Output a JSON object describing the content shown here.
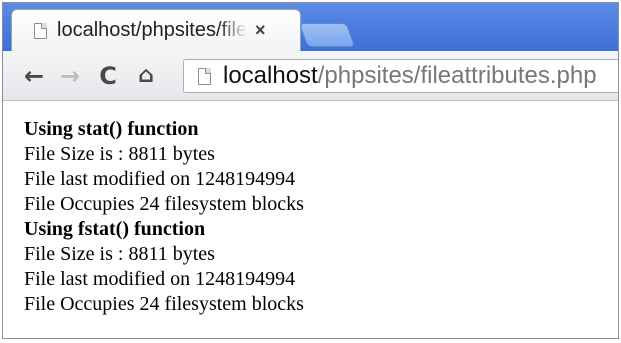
{
  "tab": {
    "title": "localhost/phpsites/file",
    "close_glyph": "×"
  },
  "toolbar": {
    "back_glyph": "←",
    "forward_glyph": "→",
    "reload_glyph": "C",
    "home_glyph": "⌂",
    "url_host": "localhost",
    "url_path": "/phpsites/fileattributes.php"
  },
  "content": {
    "section1": {
      "heading": "Using stat() function",
      "size_line": "File Size is : 8811 bytes",
      "modified_line": "File last modified on 1248194994",
      "blocks_line": "File Occupies 24 filesystem blocks"
    },
    "section2": {
      "heading": "Using fstat() function",
      "size_line": "File Size is : 8811 bytes",
      "modified_line": "File last modified on 1248194994",
      "blocks_line": "File Occupies 24 filesystem blocks"
    }
  },
  "icons": {
    "tab_page": "page-icon",
    "omni_page": "page-icon",
    "back": "back-arrow-icon",
    "forward": "forward-arrow-icon",
    "reload": "reload-icon",
    "home": "home-icon"
  },
  "colors": {
    "titlebar": "#3d6fd6",
    "url_path": "#777777"
  }
}
